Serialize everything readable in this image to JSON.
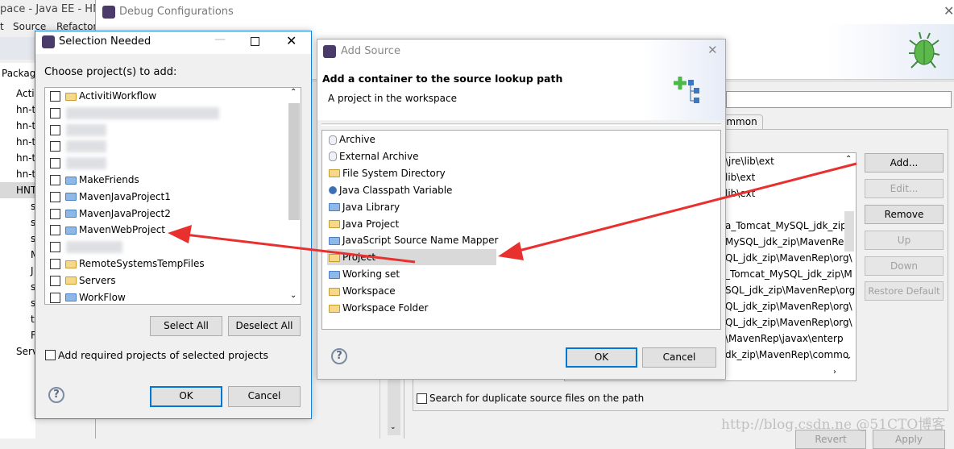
{
  "ide": {
    "title": "pace - Java EE - HNT",
    "menu": [
      "t",
      "Source",
      "Refactor"
    ],
    "explorer_tab": "Packag",
    "tree": [
      "Activi",
      "hn-t",
      "hn-t",
      "hn-t",
      "hn-t",
      "hn-t",
      "HNT",
      "s",
      "s",
      "s",
      "M",
      "J",
      "s",
      "s",
      "t",
      "F",
      "Serv"
    ]
  },
  "debug": {
    "title": "Debug Configurations",
    "tab": "ommon",
    "source_lines": [
      "\\jre\\lib\\ext",
      "lib\\ext",
      "lib\\ext",
      "",
      "a_Tomcat_MySQL_jdk_zip\\",
      "MySQL_jdk_zip\\MavenRep",
      "QL_jdk_zip\\MavenRep\\org\\",
      "_Tomcat_MySQL_jdk_zip\\M",
      "SQL_jdk_zip\\MavenRep\\org",
      "QL_jdk_zip\\MavenRep\\org\\",
      "QL_jdk_zip\\MavenRep\\org\\",
      "\\MavenRep\\javax\\enterp",
      "dk_zip\\MavenRep\\commo"
    ],
    "buttons": {
      "add": "Add...",
      "edit": "Edit...",
      "remove": "Remove",
      "up": "Up",
      "down": "Down",
      "restore": "Restore Default",
      "revert": "Revert",
      "apply": "Apply"
    },
    "duplicate_checkbox": "Search for duplicate source files on the path",
    "watermark": "http://blog.csdn.ne @51CTO博客"
  },
  "selection": {
    "title": "Selection Needed",
    "label": "Choose project(s) to add:",
    "projects": [
      {
        "name": "ActivitiWorkflow",
        "icon": "open-folder"
      },
      {
        "name": "",
        "blurred": true
      },
      {
        "name": "",
        "blurred": true
      },
      {
        "name": "",
        "blurred": true
      },
      {
        "name": "",
        "blurred": true
      },
      {
        "name": "MakeFriends",
        "icon": "folder"
      },
      {
        "name": "MavenJavaProject1",
        "icon": "folder"
      },
      {
        "name": "MavenJavaProject2",
        "icon": "folder"
      },
      {
        "name": "MavenWebProject",
        "icon": "folder"
      },
      {
        "name": "",
        "blurred": true
      },
      {
        "name": "RemoteSystemsTempFiles",
        "icon": "open-folder"
      },
      {
        "name": "Servers",
        "icon": "open-folder"
      },
      {
        "name": "WorkFlow",
        "icon": "folder"
      }
    ],
    "select_all": "Select All",
    "deselect_all": "Deselect All",
    "add_required": "Add required projects of selected projects",
    "ok": "OK",
    "cancel": "Cancel"
  },
  "add_source": {
    "title": "Add Source",
    "heading": "Add a container to the source lookup path",
    "subtitle": "A project in the workspace",
    "types": [
      "Archive",
      "External Archive",
      "File System Directory",
      "Java Classpath Variable",
      "Java Library",
      "Java Project",
      "JavaScript Source Name Mapper",
      "Project",
      "Working set",
      "Workspace",
      "Workspace Folder"
    ],
    "selected": "Project",
    "ok": "OK",
    "cancel": "Cancel"
  },
  "colors": {
    "accent": "#0078d7",
    "arrow": "#e8302e",
    "selection": "#d9d9d9"
  }
}
